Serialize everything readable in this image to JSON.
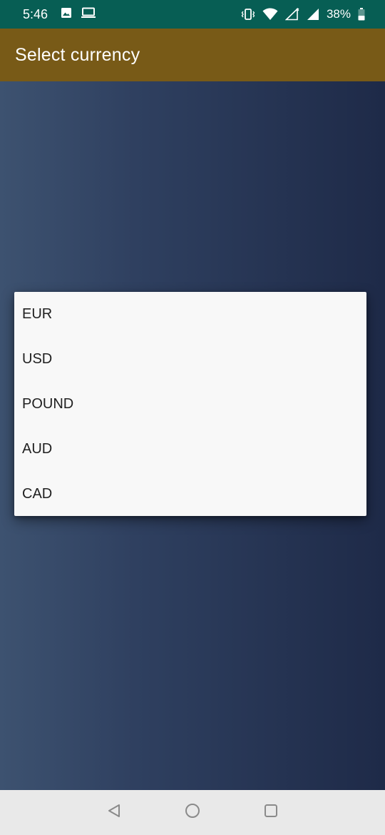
{
  "status_bar": {
    "time": "5:46",
    "battery": "38%",
    "icons_left": [
      "image-icon",
      "laptop-icon"
    ],
    "icons_right": [
      "vibrate-icon",
      "wifi-icon",
      "signal-x-icon",
      "signal-icon",
      "battery-icon"
    ]
  },
  "app_bar": {
    "title": "Select currency",
    "color": "#785a17"
  },
  "dialog": {
    "options": [
      {
        "label": "EUR"
      },
      {
        "label": "USD"
      },
      {
        "label": "POUND"
      },
      {
        "label": "AUD"
      },
      {
        "label": "CAD"
      }
    ]
  },
  "nav_bar": {
    "icons": [
      "back-icon",
      "home-icon",
      "recents-icon"
    ]
  }
}
